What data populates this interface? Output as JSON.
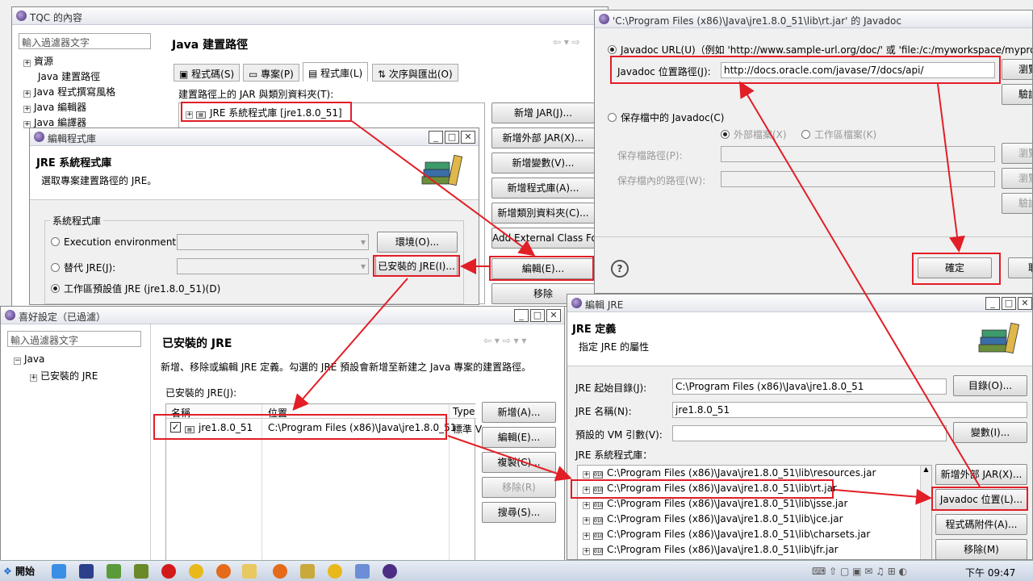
{
  "w1": {
    "title": "TQC 的內容",
    "filter_placeholder": "輸入過濾器文字",
    "tree": [
      "資源",
      "Java 建置路徑",
      "Java 程式撰寫風格",
      "Java 編輯器",
      "Java 編譯器"
    ],
    "heading": "Java 建置路徑",
    "tabs": [
      "程式碼(S)",
      "專案(P)",
      "程式庫(L)",
      "次序與匯出(O)"
    ],
    "jar_label": "建置路徑上的 JAR 與類別資料夾(T):",
    "jre_lib": "JRE 系統程式庫 [jre1.8.0_51]",
    "buttons": [
      "新增 JAR(J)...",
      "新增外部 JAR(X)...",
      "新增變數(V)...",
      "新增程式庫(A)...",
      "新增類別資料夾(C)...",
      "Add External Class Fo",
      "編輯(E)...",
      "移除"
    ]
  },
  "w2": {
    "title": "編輯程式庫",
    "heading": "JRE 系統程式庫",
    "desc": "選取專案建置路徑的 JRE。",
    "group": "系統程式庫",
    "exec_env": "Execution environment:",
    "alt_jre": "替代 JRE(J):",
    "ws_default": "工作區預設值 JRE (jre1.8.0_51)(D)",
    "env_btn": "環境(O)...",
    "installed_btn": "已安裝的 JRE(I)..."
  },
  "w3": {
    "title": "喜好設定（已過濾）",
    "filter_placeholder": "輸入過濾器文字",
    "tree_java": "Java",
    "tree_installed": "已安裝的 JRE",
    "heading": "已安裝的 JRE",
    "desc": "新增、移除或編輯 JRE 定義。勾選的 JRE 預設會新增至新建之 Java 專案的建置路徑。",
    "list_label": "已安裝的 JRE(J):",
    "columns": [
      "名稱",
      "位置",
      "Type"
    ],
    "row": {
      "name": "jre1.8.0_51",
      "location": "C:\\Program Files (x86)\\Java\\jre1.8.0_51",
      "type": "標準 V"
    },
    "buttons": [
      "新增(A)...",
      "編輯(E)...",
      "複製(C)...",
      "移除(R)",
      "搜尋(S)..."
    ]
  },
  "w4": {
    "title": "編輯 JRE",
    "heading": "JRE 定義",
    "desc": "指定 JRE 的屬性",
    "home_label": "JRE 起始目錄(J):",
    "home_value": "C:\\Program Files (x86)\\Java\\jre1.8.0_51",
    "home_btn": "目錄(O)...",
    "name_label": "JRE 名稱(N):",
    "name_value": "jre1.8.0_51",
    "vm_label": "預設的 VM 引數(V):",
    "vm_btn": "變數(I)...",
    "libs_label": "JRE 系統程式庫：",
    "jars": [
      "C:\\Program Files (x86)\\Java\\jre1.8.0_51\\lib\\resources.jar",
      "C:\\Program Files (x86)\\Java\\jre1.8.0_51\\lib\\rt.jar",
      "C:\\Program Files (x86)\\Java\\jre1.8.0_51\\lib\\jsse.jar",
      "C:\\Program Files (x86)\\Java\\jre1.8.0_51\\lib\\jce.jar",
      "C:\\Program Files (x86)\\Java\\jre1.8.0_51\\lib\\charsets.jar",
      "C:\\Program Files (x86)\\Java\\jre1.8.0_51\\lib\\jfr.jar"
    ],
    "buttons": [
      "新增外部 JAR(X)...",
      "Javadoc 位置(L)...",
      "程式碼附件(A)...",
      "移除(M)"
    ]
  },
  "w5": {
    "title": "'C:\\Program Files (x86)\\Java\\jre1.8.0_51\\lib\\rt.jar' 的 Javadoc",
    "url_radio": "Javadoc URL(U)（例如 'http://www.sample-url.org/doc/' 或 'file:/c:/myworkspace/myproject",
    "loc_label": "Javadoc 位置路徑(J):",
    "loc_value": "http://docs.oracle.com/javase/7/docs/api/",
    "browse": "瀏覽",
    "validate": "驗證",
    "archive_radio": "保存檔中的 Javadoc(C)",
    "external": "外部檔案(X)",
    "workspace": "工作區檔案(K)",
    "archive_path": "保存檔路徑(P):",
    "archive_inner": "保存檔內的路徑(W):",
    "ok": "確定",
    "cancel": "取"
  },
  "taskbar": {
    "start": "開始",
    "time": "下午 09:47"
  }
}
